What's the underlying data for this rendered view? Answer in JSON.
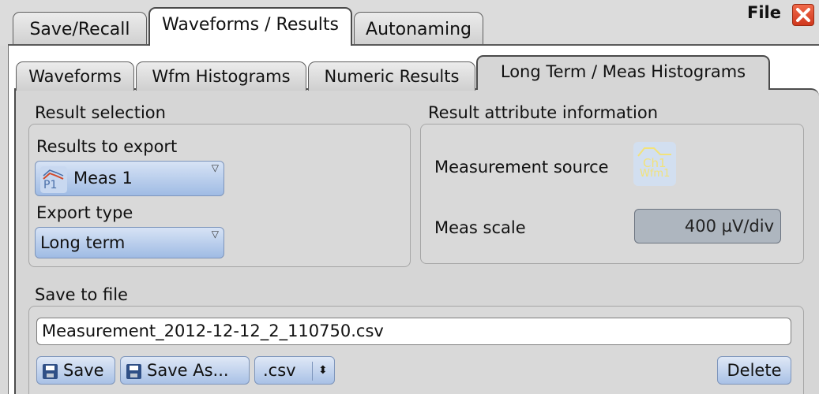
{
  "window": {
    "title": "File"
  },
  "top_tabs": [
    {
      "label": "Save/Recall"
    },
    {
      "label": "Waveforms / Results"
    },
    {
      "label": "Autonaming"
    }
  ],
  "sub_tabs": [
    {
      "label": "Waveforms"
    },
    {
      "label": "Wfm Histograms"
    },
    {
      "label": "Numeric Results"
    },
    {
      "label": "Long Term / Meas Histograms"
    }
  ],
  "result_selection": {
    "title": "Result selection",
    "results_to_export_label": "Results to export",
    "results_to_export_value": "Meas 1",
    "results_icon_text": "P1",
    "export_type_label": "Export type",
    "export_type_value": "Long term"
  },
  "attribute_info": {
    "title": "Result attribute information",
    "source_label": "Measurement source",
    "source_icon_line1": "Ch1",
    "source_icon_line2": "Wfm1",
    "scale_label": "Meas scale",
    "scale_value": "400 µV/div"
  },
  "save_to_file": {
    "title": "Save to file",
    "filename": "Measurement_2012-12-12_2_110750.csv",
    "save_label": "Save",
    "save_as_label": "Save As...",
    "format_value": ".csv",
    "delete_label": "Delete"
  },
  "colors": {
    "close": "#d0381e",
    "button_blue": "#a9c1e6",
    "icon_yellow": "#f2e27a"
  }
}
